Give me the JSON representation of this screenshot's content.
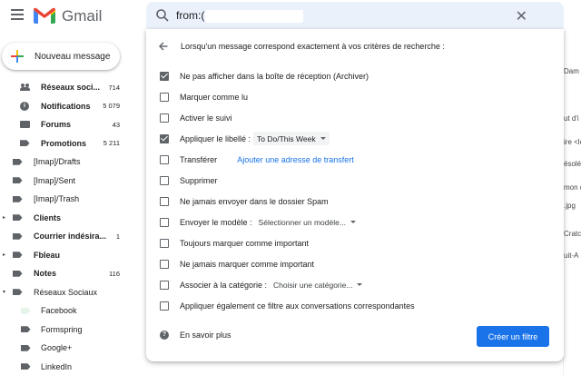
{
  "app": {
    "name": "Gmail",
    "brand_colors": {
      "red": "#ea4335",
      "blue": "#4285f4",
      "green": "#34a853",
      "yellow": "#fbbc04"
    }
  },
  "search": {
    "query": "from:(",
    "close_icon": "close-icon"
  },
  "compose": {
    "label": "Nouveau message"
  },
  "sidebar": {
    "items": [
      {
        "name": "Réseaux soci...",
        "count": "714",
        "icon": "people-icon",
        "bold": true,
        "expander": ""
      },
      {
        "name": "Notifications",
        "count": "5 079",
        "icon": "info-icon",
        "bold": true,
        "expander": ""
      },
      {
        "name": "Forums",
        "count": "43",
        "icon": "forum-icon",
        "bold": true,
        "expander": ""
      },
      {
        "name": "Promotions",
        "count": "5 211",
        "icon": "tag-icon",
        "bold": true,
        "expander": ""
      },
      {
        "name": "[Imap]/Drafts",
        "count": "",
        "icon": "label-icon",
        "bold": false,
        "expander": ""
      },
      {
        "name": "[Imap]/Sent",
        "count": "",
        "icon": "label-icon",
        "bold": false,
        "expander": ""
      },
      {
        "name": "[Imap]/Trash",
        "count": "",
        "icon": "label-icon",
        "bold": false,
        "expander": ""
      },
      {
        "name": "Clients",
        "count": "",
        "icon": "label-icon",
        "bold": true,
        "expander": "▸"
      },
      {
        "name": "Courrier indésira...",
        "count": "1",
        "icon": "label-icon",
        "bold": true,
        "expander": ""
      },
      {
        "name": "Fbleau",
        "count": "",
        "icon": "label-icon",
        "bold": true,
        "expander": "▸"
      },
      {
        "name": "Notes",
        "count": "116",
        "icon": "label-icon",
        "bold": true,
        "expander": ""
      },
      {
        "name": "Réseaux Sociaux",
        "count": "",
        "icon": "label-icon",
        "bold": false,
        "expander": "▾"
      },
      {
        "name": "Facebook",
        "count": "",
        "icon": "light-label-icon",
        "bold": false,
        "expander": ""
      },
      {
        "name": "Formspring",
        "count": "",
        "icon": "label-icon",
        "bold": false,
        "expander": ""
      },
      {
        "name": "Google+",
        "count": "",
        "icon": "label-icon",
        "bold": false,
        "expander": ""
      },
      {
        "name": "LinkedIn",
        "count": "",
        "icon": "label-icon",
        "bold": false,
        "expander": ""
      }
    ]
  },
  "list_strip": [
    "Dam",
    "",
    "ut d'i",
    "ire <lc",
    "ésolé",
    "mon c",
    ".jpg",
    "Cratc",
    "uit-A"
  ],
  "dialog": {
    "heading": "Lorsqu'un message correspond exactement à vos critères de recherche :",
    "options": [
      {
        "label": "Ne pas afficher dans la boîte de réception (Archiver)",
        "checked": true
      },
      {
        "label": "Marquer comme lu",
        "checked": false
      },
      {
        "label": "Activer le suivi",
        "checked": false
      },
      {
        "label": "Appliquer le libellé :",
        "checked": true,
        "select": "To Do/This Week"
      },
      {
        "label": "Transférer",
        "checked": false,
        "link": "Ajouter une adresse de transfert"
      },
      {
        "label": "Supprimer",
        "checked": false
      },
      {
        "label": "Ne jamais envoyer dans le dossier Spam",
        "checked": false
      },
      {
        "label": "Envoyer le modèle :",
        "checked": false,
        "select_plain": "Sélectionner un modèle..."
      },
      {
        "label": "Toujours marquer comme important",
        "checked": false
      },
      {
        "label": "Ne jamais marquer comme important",
        "checked": false
      },
      {
        "label": "Associer à la catégorie :",
        "checked": false,
        "select_plain": "Choisir une catégorie..."
      },
      {
        "label": "Appliquer également ce filtre aux conversations correspondantes",
        "checked": false
      }
    ],
    "learn_more": "En savoir plus",
    "create_button": "Créer un filtre"
  }
}
